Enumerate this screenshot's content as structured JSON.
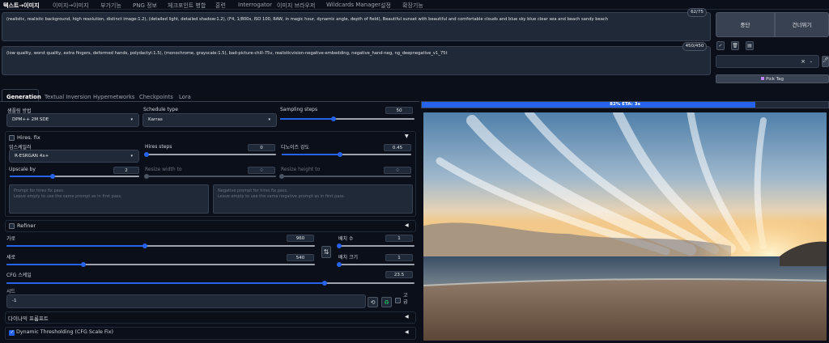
{
  "nav": [
    "텍스트→이미지",
    "이미지→이미지",
    "부가기능",
    "PNG 정보",
    "체크포인트 병합",
    "훈련",
    "Interrogator",
    "이미지 브라우저",
    "Wildcards Manager",
    "설정",
    "확장기능"
  ],
  "prompt": {
    "positive": "(realistic, realistic background, high resolution, distinct image:1.2), (detailed light, detailed shadow:1.2), (F4, 1/800s, ISO 100, RAW, in magic hour, dynamic angle, depth of field), Beautiful sunset with beautiful and comfortable clouds and blue sky blue clear sea and beach sandy beach",
    "positive_count": "62/75",
    "negative": "(low quality, worst quality, extra fingers, deformed hands, polydactyl:1.5), (monochrome, grayscale:1.5), bad-picture-chill-75v, realisticvision-negative-embedding, negative_hand-neg, ng_deepnegative_v1_75t",
    "negative_count": "450/450"
  },
  "actions": {
    "interrupt": "중단",
    "skip": "건너뛰기",
    "pick_tag": "Pick Tag",
    "clear": "×",
    "dropdown": "⌄",
    "icon_check": "✓",
    "icon_trash": "🗑",
    "icon_doc": "▤",
    "icon_pen": "🖊"
  },
  "tabs": [
    "Generation",
    "Textual Inversion",
    "Hypernetworks",
    "Checkpoints",
    "Lora"
  ],
  "sampling": {
    "method_label": "샘플링 방법",
    "method": "DPM++ 2M SDE",
    "schedule_label": "Schedule type",
    "schedule": "Karras",
    "steps_label": "Sampling steps",
    "steps": "50",
    "steps_frac": 0.4
  },
  "hires": {
    "title": "Hires. fix",
    "upscaler_label": "업스케일러",
    "upscaler": "R-ESRGAN 4x+",
    "steps_label": "Hires steps",
    "steps": "0",
    "steps_frac": 0.0,
    "denoise_label": "디노이즈 강도",
    "denoise": "0.45",
    "denoise_frac": 0.45,
    "upscale_label": "Upscale by",
    "upscale": "2",
    "upscale_frac": 0.33,
    "rw_label": "Resize width to",
    "rw": "0",
    "rh_label": "Resize height to",
    "rh": "0",
    "prompt_ph1": "Prompt for hires fix pass.",
    "prompt_ph2": "Leave empty to use the same prompt as in first pass.",
    "neg_ph1": "Negative prompt for hires fix pass.",
    "neg_ph2": "Leave empty to use the same negative prompt as in first pass."
  },
  "refiner": {
    "title": "Refiner"
  },
  "size": {
    "width_label": "가로",
    "width": "960",
    "width_frac": 0.45,
    "height_label": "세로",
    "height": "540",
    "height_frac": 0.25,
    "batch_count_label": "배치 수",
    "batch_count": "1",
    "batch_size_label": "배치 크기",
    "batch_size": "1",
    "swap": "⇅"
  },
  "cfg": {
    "label": "CFG 스케일",
    "value": "23.5",
    "frac": 0.78
  },
  "seed": {
    "label": "시드",
    "value": "-1",
    "extra": "고급",
    "dice": "⟲",
    "recycle": "♻"
  },
  "dynamic_prompts": {
    "title": "다이나믹 프롬프트"
  },
  "dynamic_thresholding": {
    "title": "Dynamic Thresholding (CFG Scale Fix)"
  },
  "progress": {
    "text": "82% ETA: 3s",
    "frac": 0.82
  },
  "colors": {
    "accent": "#2563eb",
    "bg": "#0b0f19",
    "panel": "#1f2937"
  }
}
